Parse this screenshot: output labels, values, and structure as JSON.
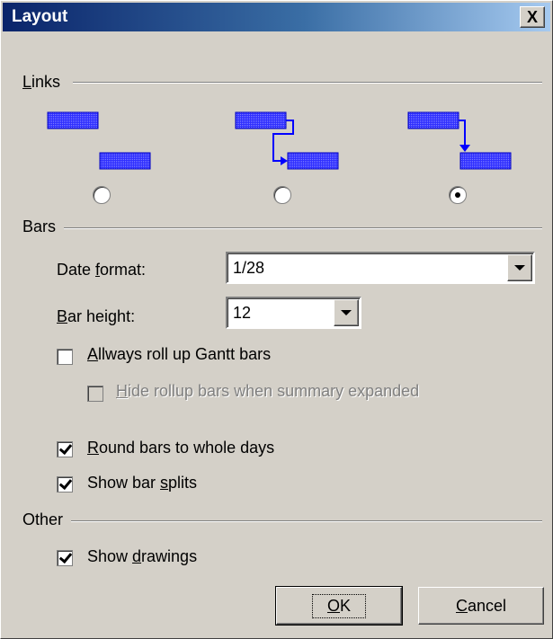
{
  "window": {
    "title": "Layout",
    "close_label": "X"
  },
  "links": {
    "group_label": "Links",
    "group_mnemonic": "L",
    "options": [
      {
        "name": "no-arrow-link",
        "selected": false
      },
      {
        "name": "down-right-arrow-link",
        "selected": false
      },
      {
        "name": "down-arrow-link",
        "selected": true
      }
    ]
  },
  "bars": {
    "group_label": "Bars",
    "date_format": {
      "label_pre": "Date ",
      "label_mn": "f",
      "label_post": "ormat:",
      "value": "1/28"
    },
    "bar_height": {
      "label_mn": "B",
      "label_post": "ar height:",
      "value": "12"
    },
    "rollup": {
      "label_mn": "A",
      "label_post": "llways roll up Gantt bars",
      "checked": false
    },
    "hide_rollup": {
      "label_mn": "H",
      "label_post": "ide rollup bars when summary expanded",
      "checked": false,
      "enabled": false
    },
    "round_bars": {
      "label_mn": "R",
      "label_post": "ound bars to whole days",
      "checked": true
    },
    "bar_splits": {
      "label_pre": "Show bar ",
      "label_mn": "s",
      "label_post": "plits",
      "checked": true
    }
  },
  "other": {
    "group_label": "Other",
    "show_drawings": {
      "label_pre": "Show ",
      "label_mn": "d",
      "label_post": "rawings",
      "checked": true
    }
  },
  "buttons": {
    "ok": {
      "mn": "O",
      "rest": "K"
    },
    "cancel": {
      "mn": "C",
      "rest": "ancel"
    }
  },
  "colors": {
    "bar_fill": "#5050ff",
    "bar_border": "#0000c0",
    "link_line": "#0000ff",
    "title_bar": "#0a246a"
  }
}
